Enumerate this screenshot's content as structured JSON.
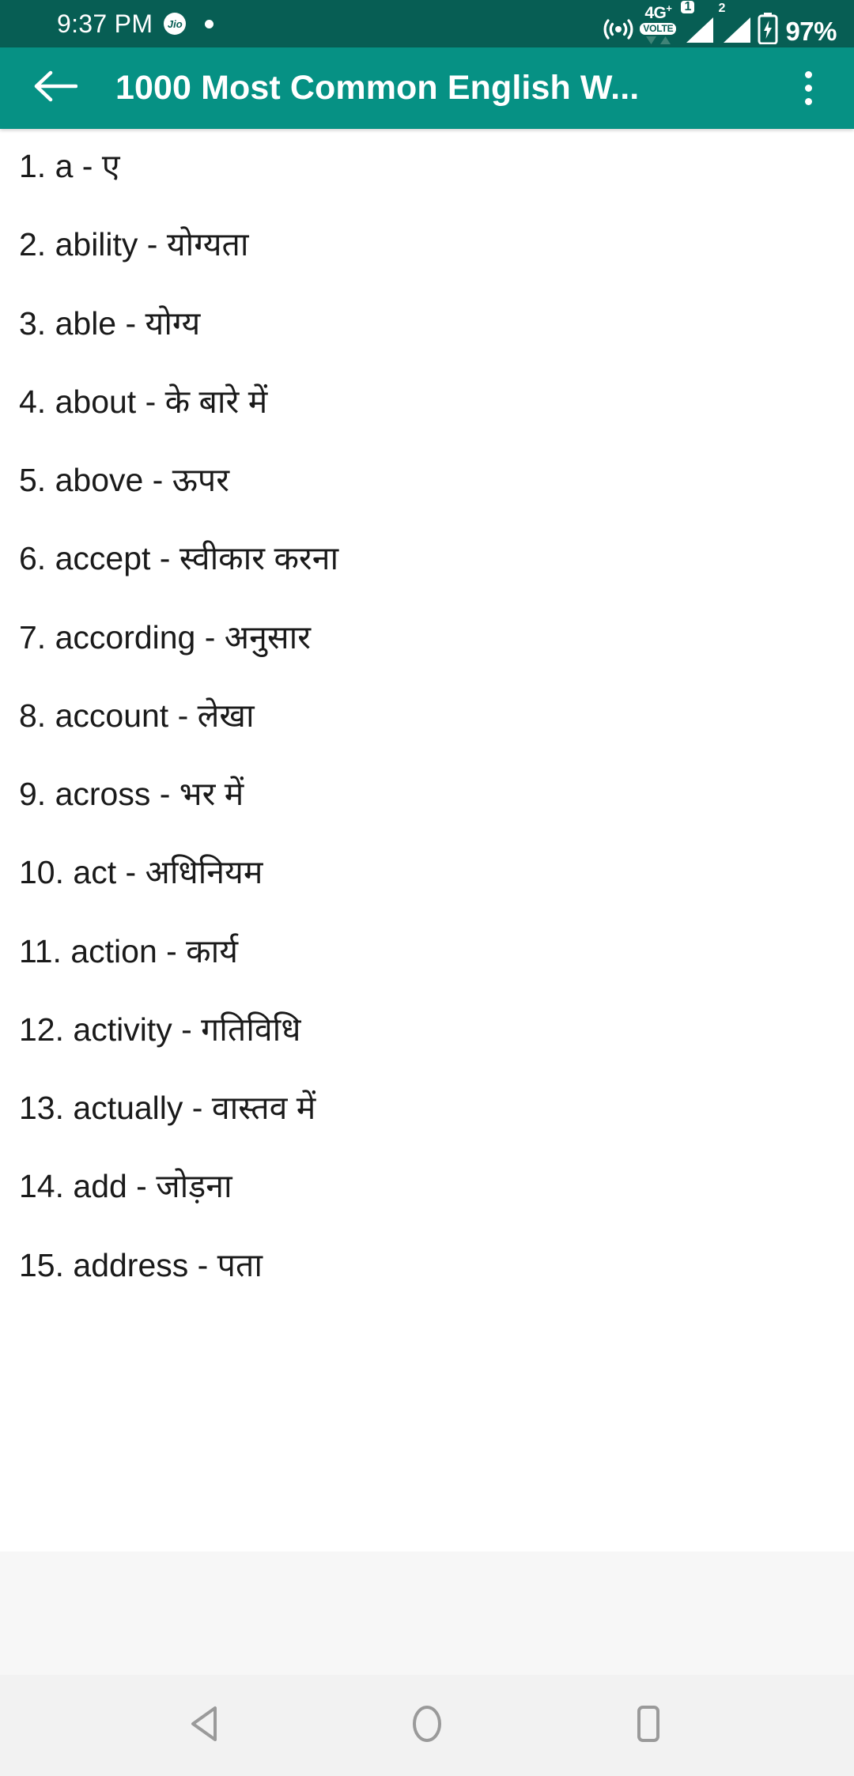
{
  "status_bar": {
    "time": "9:37 PM",
    "carrier_badge": "Jio",
    "notification_dot": "•",
    "network_type": "4G",
    "network_plus": "+",
    "volte_label": "VOLTE",
    "sim1_label": "1",
    "sim2_label": "2",
    "battery_percent": "97%",
    "background_color": "#075E54",
    "icons": [
      "hotspot-icon",
      "volte-icon",
      "signal-sim1-icon",
      "signal-sim2-icon",
      "battery-charging-icon"
    ]
  },
  "app_bar": {
    "title": "1000 Most Common English W...",
    "back_icon": "arrow-back-icon",
    "overflow_icon": "more-vertical-icon",
    "background_color": "#069184",
    "text_color": "#FFFFFF"
  },
  "word_list": [
    "1. a - ए",
    "2. ability - योग्यता",
    "3. able - योग्य",
    "4. about - के बारे में",
    "5. above - ऊपर",
    "6. accept - स्वीकार करना",
    "7. according - अनुसार",
    "8. account - लेखा",
    "9. across - भर में",
    "10. act - अधिनियम",
    "11. action - कार्य",
    "12. activity - गतिविधि",
    "13. actually - वास्तव में",
    "14. add - जोड़ना",
    "15. address - पता"
  ],
  "nav_bar": {
    "back_label": "back-triangle-icon",
    "home_label": "home-circle-icon",
    "recents_label": "recents-square-icon",
    "background_color": "#F2F2F2",
    "icon_color": "#9A9A9A"
  }
}
